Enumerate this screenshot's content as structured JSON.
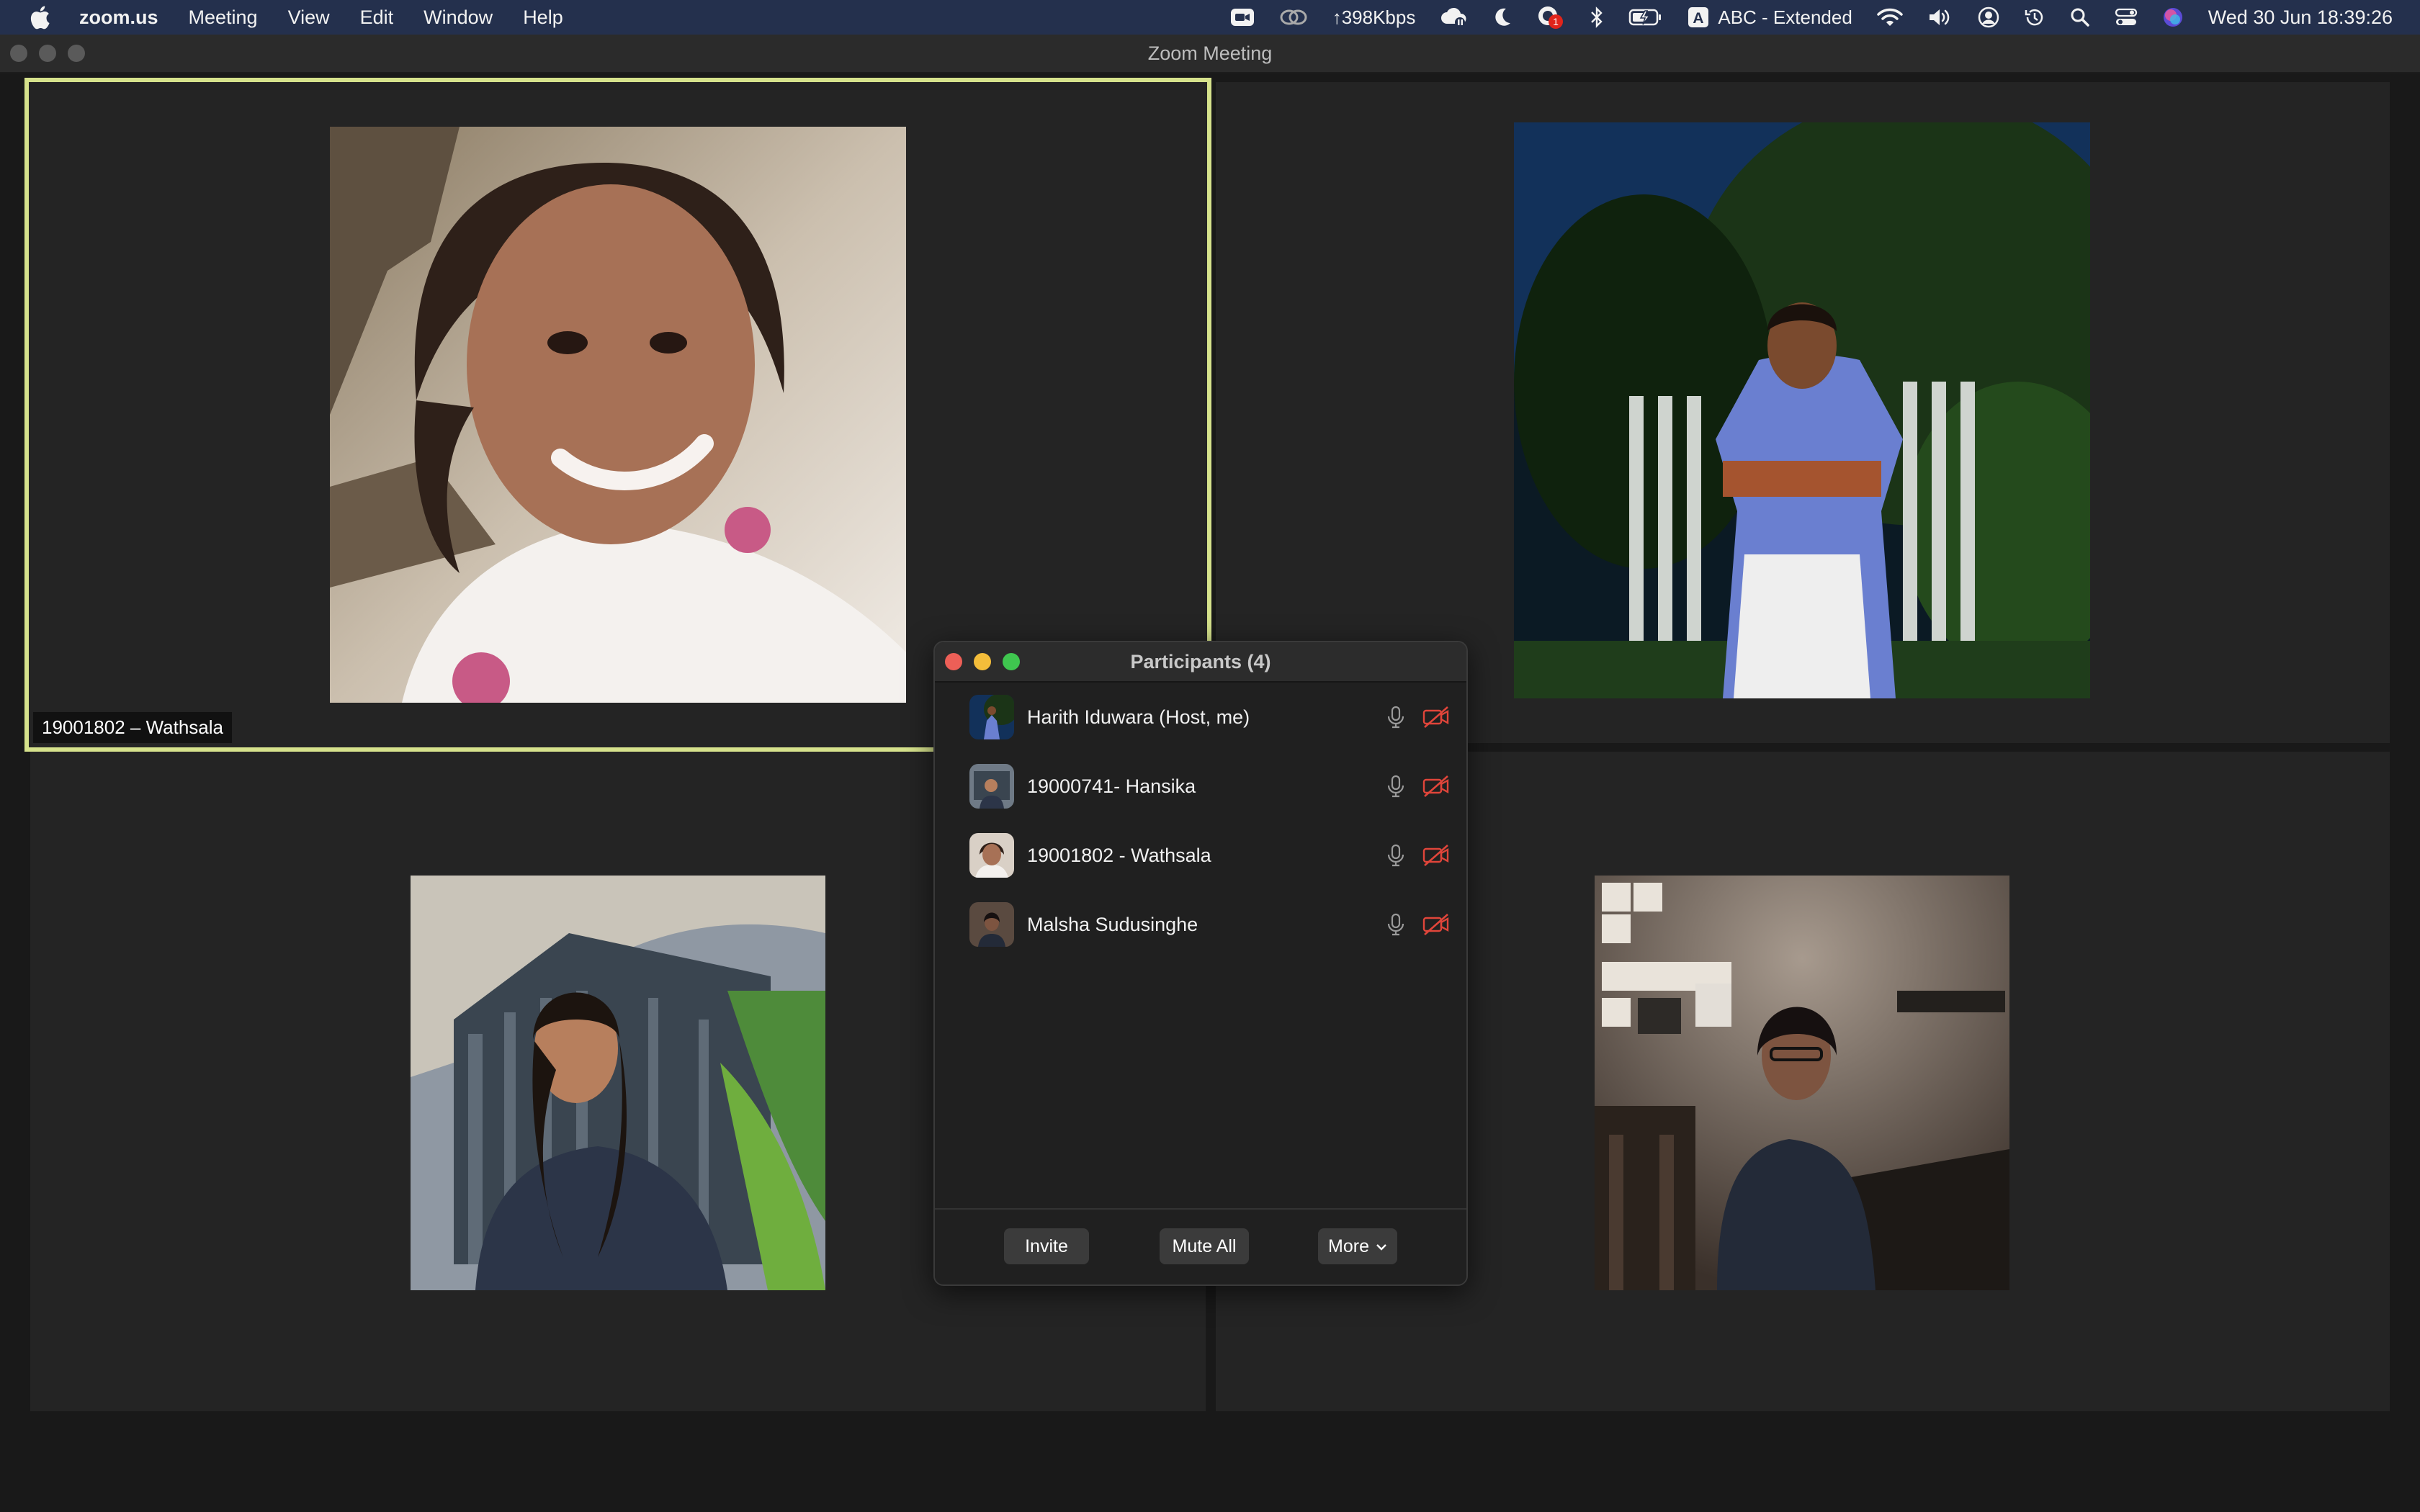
{
  "menubar": {
    "apple_icon": "apple-logo-icon",
    "app_name": "zoom.us",
    "menus": [
      "Meeting",
      "View",
      "Edit",
      "Window",
      "Help"
    ],
    "status": {
      "network_speed": "↑398Kbps",
      "input_source": "ABC - Extended",
      "input_source_badge": "A",
      "notification_badge": "1",
      "clock": "Wed 30 Jun  18:39:26"
    }
  },
  "window": {
    "title": "Zoom Meeting"
  },
  "gallery": {
    "active_speaker_label": "19001802 – Wathsala",
    "active_border_color": "#d6e28c"
  },
  "participants_panel": {
    "title": "Participants (4)",
    "participants": [
      {
        "name": "Harith Iduwara (Host, me)"
      },
      {
        "name": "19000741- Hansika"
      },
      {
        "name": "19001802 - Wathsala"
      },
      {
        "name": "Malsha Sudusinghe"
      }
    ],
    "buttons": {
      "invite": "Invite",
      "mute_all": "Mute All",
      "more": "More"
    },
    "video_off_color": "#e0453a"
  }
}
